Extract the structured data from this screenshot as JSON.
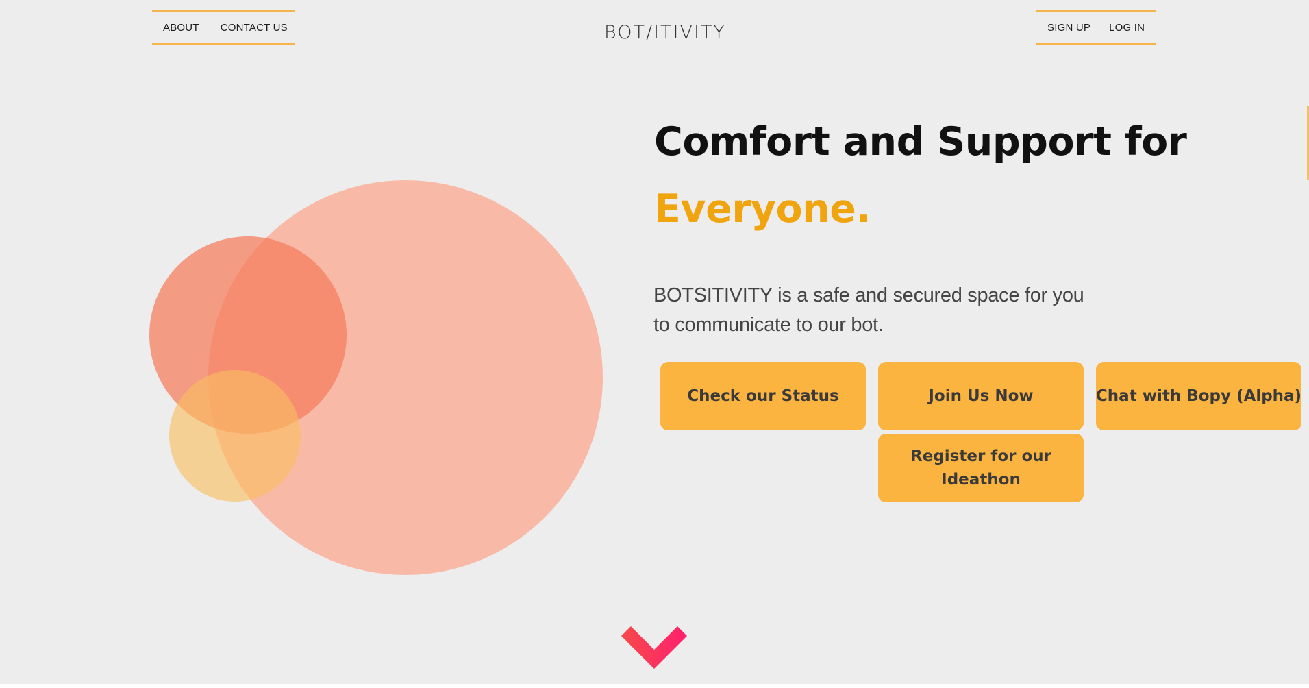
{
  "header": {
    "left_links": [
      "ABOUT",
      "CONTACT US"
    ],
    "brand": "BOT/ITIVITY",
    "right_links": [
      "SIGN UP",
      "LOG IN"
    ]
  },
  "hero": {
    "headline_line1": "Comfort and Support for",
    "headline_accent": "Everyone.",
    "description": "BOTSITIVITY is a safe and secured space for you to communicate to our bot.",
    "buttons": {
      "status": "Check our Status",
      "join": "Join Us Now",
      "chat": "Chat with Bopy (Alpha)",
      "register": "Register for our Ideathon"
    }
  },
  "icons": {
    "scroll": "chevron-down-icon",
    "decoration": "overlapping-circles-illustration"
  },
  "colors": {
    "background": "#ededed",
    "accent_gold": "#f0a50f",
    "nav_border": "#f5b54a",
    "button_fill": "#fcb441",
    "circle_large": "#f9b9a7",
    "circle_medium": "#f78d70",
    "circle_small": "#f7c775",
    "chevron_start": "#f74a4a",
    "chevron_end": "#ff1f6e"
  }
}
